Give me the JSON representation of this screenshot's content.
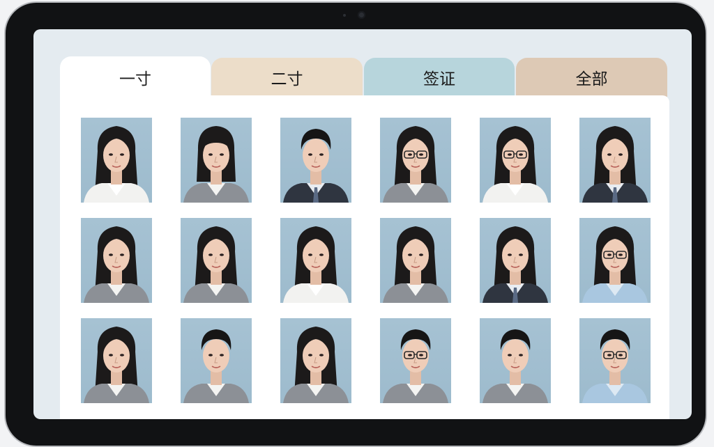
{
  "tabs": [
    {
      "label": "一寸",
      "active": true
    },
    {
      "label": "二寸",
      "active": false
    },
    {
      "label": "签证",
      "active": false
    },
    {
      "label": "全部",
      "active": false
    }
  ],
  "colors": {
    "tab_active": "#ffffff",
    "tab_two": "#ecddc9",
    "tab_visa": "#b7d5dc",
    "tab_all": "#ddc9b5",
    "photo_background": "#a6c2d3"
  },
  "photos": [
    {
      "hair": "long",
      "glasses": false,
      "attire": "white-shirt"
    },
    {
      "hair": "bangs",
      "glasses": false,
      "attire": "grey-blazer"
    },
    {
      "hair": "short",
      "glasses": false,
      "attire": "dark-suit"
    },
    {
      "hair": "long",
      "glasses": true,
      "attire": "grey-blazer"
    },
    {
      "hair": "long",
      "glasses": true,
      "attire": "white-shirt"
    },
    {
      "hair": "long",
      "glasses": false,
      "attire": "dark-suit"
    },
    {
      "hair": "long",
      "glasses": false,
      "attire": "grey-blazer"
    },
    {
      "hair": "long",
      "glasses": false,
      "attire": "grey-blazer"
    },
    {
      "hair": "long",
      "glasses": false,
      "attire": "white-shirt"
    },
    {
      "hair": "long",
      "glasses": false,
      "attire": "grey-blazer"
    },
    {
      "hair": "long",
      "glasses": false,
      "attire": "dark-suit"
    },
    {
      "hair": "long",
      "glasses": true,
      "attire": "light-blue"
    },
    {
      "hair": "long",
      "glasses": false,
      "attire": "grey-blazer"
    },
    {
      "hair": "short",
      "glasses": false,
      "attire": "grey-blazer"
    },
    {
      "hair": "long",
      "glasses": false,
      "attire": "grey-blazer"
    },
    {
      "hair": "short",
      "glasses": true,
      "attire": "grey-blazer"
    },
    {
      "hair": "short",
      "glasses": false,
      "attire": "grey-blazer"
    },
    {
      "hair": "short",
      "glasses": true,
      "attire": "light-blue"
    }
  ]
}
